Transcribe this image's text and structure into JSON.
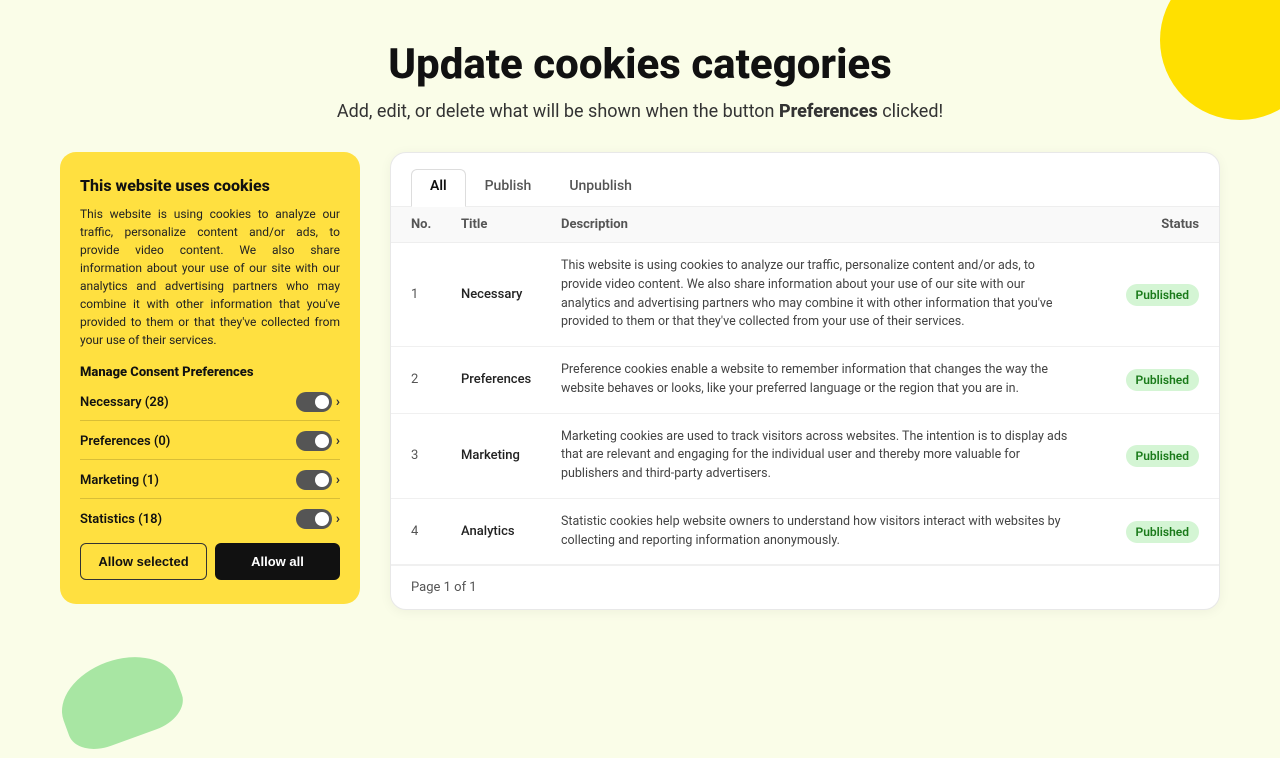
{
  "page": {
    "title": "Update cookies categories",
    "subtitle_pre": "Add, edit, or delete what will be shown when the button",
    "subtitle_bold": "Preferences",
    "subtitle_post": "clicked!"
  },
  "cookie_card": {
    "title": "This website uses cookies",
    "description": "This website is using cookies to analyze our traffic, personalize content and/or ads, to provide video content. We also share information about your use of our site with our analytics and advertising partners who may combine it with other information that you've provided to them or that they've collected from your use of their services.",
    "manage_label": "Manage Consent Preferences",
    "categories": [
      {
        "label": "Necessary (28)"
      },
      {
        "label": "Preferences (0)"
      },
      {
        "label": "Marketing (1)"
      },
      {
        "label": "Statistics (18)"
      }
    ],
    "btn_allow_selected": "Allow selected",
    "btn_allow_all": "Allow all"
  },
  "table": {
    "tabs": [
      {
        "label": "All",
        "active": true
      },
      {
        "label": "Publish",
        "active": false
      },
      {
        "label": "Unpublish",
        "active": false
      }
    ],
    "columns": [
      {
        "key": "no",
        "label": "No."
      },
      {
        "key": "title",
        "label": "Title"
      },
      {
        "key": "description",
        "label": "Description"
      },
      {
        "key": "status",
        "label": "Status"
      }
    ],
    "rows": [
      {
        "no": "1",
        "title": "Necessary",
        "description": "This website is using cookies to analyze our traffic, personalize content and/or ads, to provide video content. We also share information about your use of our site with our analytics and advertising partners who may combine it with other information that you've provided to them or that they've collected from your use of their services.",
        "status": "Published"
      },
      {
        "no": "2",
        "title": "Preferences",
        "description": "Preference cookies enable a website to remember information that changes the way the website behaves or looks, like your preferred language or the region that you are in.",
        "status": "Published"
      },
      {
        "no": "3",
        "title": "Marketing",
        "description": "Marketing cookies are used to track visitors across websites. The intention is to display ads that are relevant and engaging for the individual user and thereby more valuable for publishers and third-party advertisers.",
        "status": "Published"
      },
      {
        "no": "4",
        "title": "Analytics",
        "description": "Statistic cookies help website owners to understand how visitors interact with websites by collecting and reporting information anonymously.",
        "status": "Published"
      }
    ],
    "footer": "Page 1 of 1"
  }
}
